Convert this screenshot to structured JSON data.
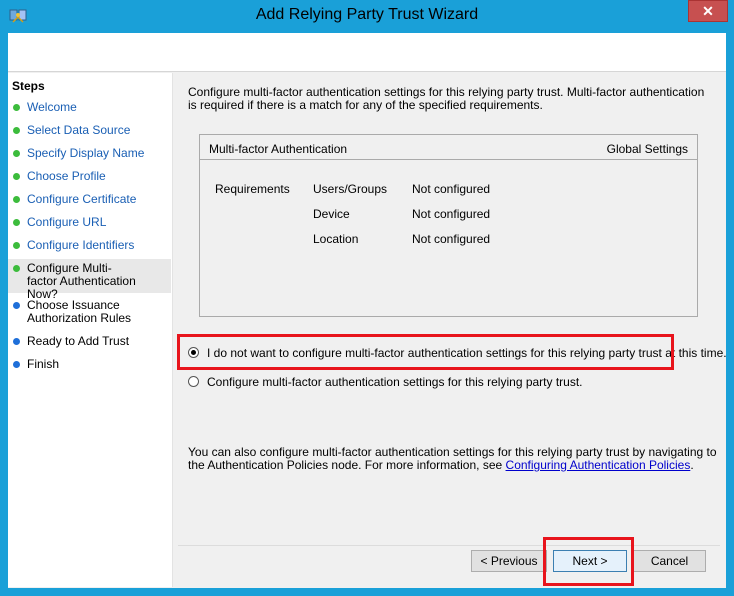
{
  "window": {
    "title": "Add Relying Party Trust Wizard",
    "close_symbol": "✕"
  },
  "steps": {
    "title": "Steps",
    "items": [
      {
        "label": "Welcome",
        "state": "done"
      },
      {
        "label": "Select Data Source",
        "state": "done"
      },
      {
        "label": "Specify Display Name",
        "state": "done"
      },
      {
        "label": "Choose Profile",
        "state": "done"
      },
      {
        "label": "Configure Certificate",
        "state": "done"
      },
      {
        "label": "Configure URL",
        "state": "done"
      },
      {
        "label": "Configure Identifiers",
        "state": "done"
      },
      {
        "label": "Configure Multi-factor Authentication Now?",
        "state": "current"
      },
      {
        "label": "Choose Issuance Authorization Rules",
        "state": "todo"
      },
      {
        "label": "Ready to Add Trust",
        "state": "todo"
      },
      {
        "label": "Finish",
        "state": "todo"
      }
    ]
  },
  "content": {
    "intro": "Configure multi-factor authentication settings for this relying party trust. Multi-factor authentication is required if there is a match for any of the specified requirements.",
    "mfa_table": {
      "header_left": "Multi-factor Authentication",
      "header_right": "Global Settings",
      "requirements_label": "Requirements",
      "rows": [
        {
          "name": "Users/Groups",
          "value": "Not configured"
        },
        {
          "name": "Device",
          "value": "Not configured"
        },
        {
          "name": "Location",
          "value": "Not configured"
        }
      ]
    },
    "option_skip": "I do not want to configure multi-factor authentication settings for this relying party trust at this time.",
    "option_configure": "Configure multi-factor authentication settings for this relying party trust.",
    "footer_text": "You can also configure multi-factor authentication settings for this relying party trust by navigating to the Authentication Policies node. For more information, see",
    "footer_link": "Configuring Authentication Policies",
    "footer_end": "."
  },
  "buttons": {
    "previous": "< Previous",
    "next": "Next >",
    "cancel": "Cancel"
  },
  "colors": {
    "title_bar": "#1aa0d8",
    "highlight": "#e8141c",
    "done_dot": "#3cbc3c",
    "todo_dot": "#1e6fd9"
  }
}
